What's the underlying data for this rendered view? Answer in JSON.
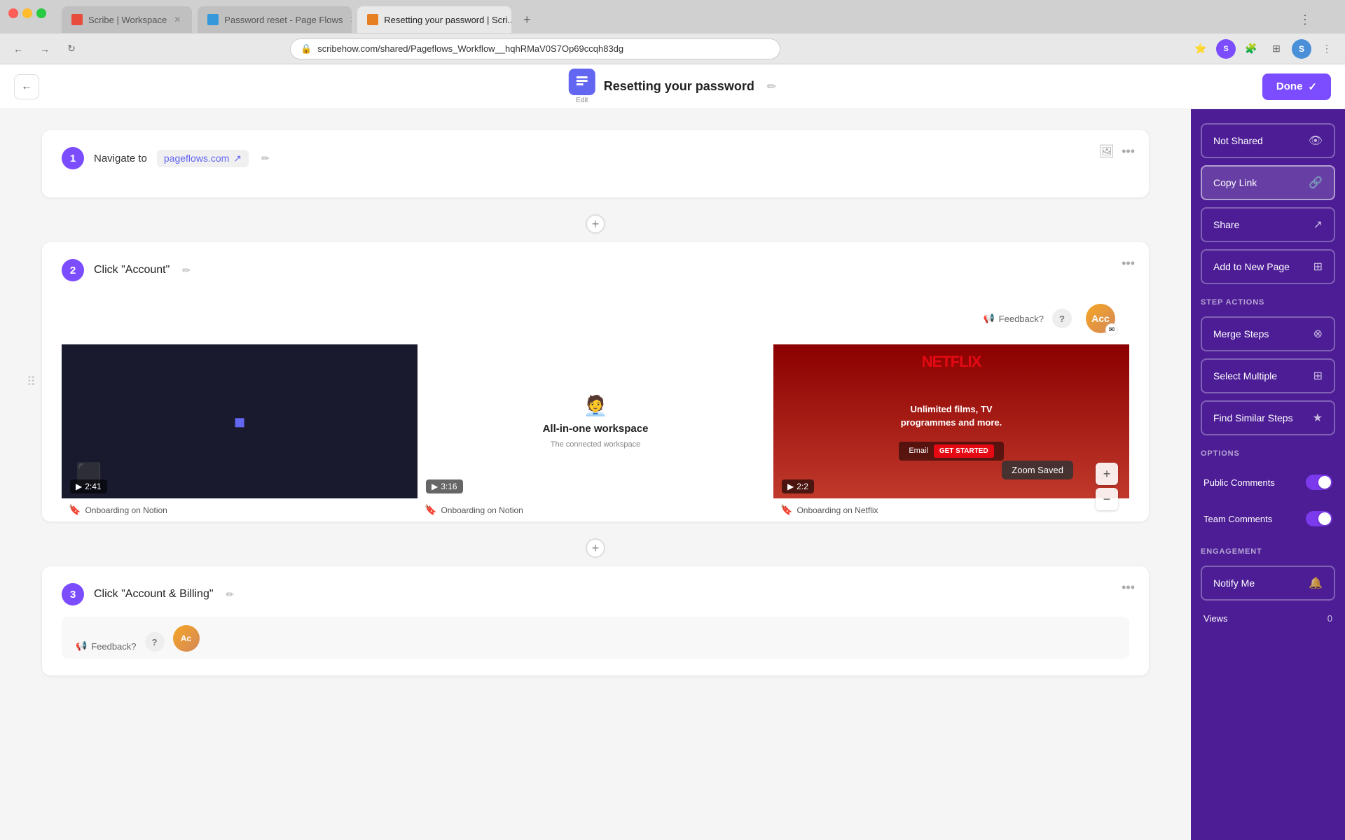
{
  "browser": {
    "tabs": [
      {
        "id": "scribe-workspace",
        "label": "Scribe | Workspace",
        "favicon_color": "red",
        "active": false
      },
      {
        "id": "password-reset",
        "label": "Password reset - Page Flows",
        "favicon_color": "blue",
        "active": false
      },
      {
        "id": "resetting-password",
        "label": "Resetting your password | Scri...",
        "favicon_color": "orange",
        "active": true
      }
    ],
    "url": "scribehow.com/shared/Pageflows_Workflow__hqhRMaV0S7Op69ccqh83dg",
    "nav_back": "←",
    "nav_forward": "→",
    "nav_refresh": "↻"
  },
  "topbar": {
    "back_label": "←",
    "title": "Resetting your password",
    "edit_icon": "✏️",
    "done_label": "Done",
    "check_icon": "✓",
    "logo_edit": "Edit"
  },
  "steps": [
    {
      "number": "1",
      "title": "Navigate to",
      "link_text": "pageflows.com",
      "link_icon": "↗",
      "pencil": "✏️",
      "has_image": true,
      "image_icon": "🖼️"
    },
    {
      "number": "2",
      "title": "Click \"Account\"",
      "pencil": "✏️",
      "feedback_label": "Feedback?",
      "help_icon": "?",
      "account_label": "Acco",
      "gallery": [
        {
          "bg": "dark",
          "video_time": "2:41",
          "caption": "Onboarding on Notion"
        },
        {
          "bg": "notion",
          "video_time": "3:16",
          "caption": "Onboarding on Notion"
        },
        {
          "bg": "netflix",
          "video_time": "2:2",
          "caption": "Onboarding on Netflix"
        }
      ],
      "zoom_saved": "Zoom Saved",
      "zoom_in": "+",
      "zoom_out": "−"
    },
    {
      "number": "3",
      "title": "Click \"Account & Billing\"",
      "pencil": "✏️",
      "feedback_label": "Feedback?",
      "help_icon": "?"
    }
  ],
  "right_panel": {
    "not_shared_label": "Not Shared",
    "not_shared_icon": "👁",
    "copy_link_label": "Copy Link",
    "copy_link_icon": "🔗",
    "share_label": "Share",
    "share_icon": "↗",
    "add_to_page_label": "Add to New Page",
    "add_to_page_icon": "⊞",
    "step_actions_title": "STEP ACTIONS",
    "merge_steps_label": "Merge Steps",
    "merge_icon": "⊗",
    "select_multiple_label": "Select Multiple",
    "select_icon": "⊞",
    "find_similar_label": "Find Similar Steps",
    "find_icon": "★",
    "options_title": "OPTIONS",
    "public_comments_label": "Public Comments",
    "public_comments_on": true,
    "team_comments_label": "Team Comments",
    "team_comments_on": true,
    "engagement_title": "ENGAGEMENT",
    "notify_me_label": "Notify Me",
    "notify_icon": "🔔",
    "views_label": "Views",
    "views_count": "0"
  }
}
